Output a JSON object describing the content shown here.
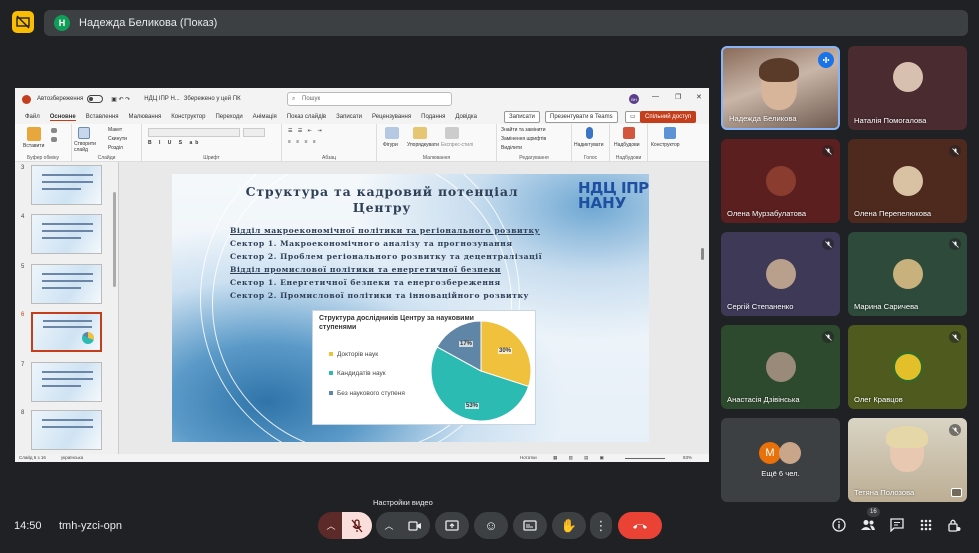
{
  "header": {
    "presenter_initial": "Н",
    "presenting_title": "Надежда Беликова (Показ)"
  },
  "ppt": {
    "autosave_label": "Автозбереження",
    "filename": "НДЦ ІПР Н...",
    "saved_status": "Збережено у цей ПК",
    "search_placeholder": "Пошук",
    "user_initials": "ВН",
    "menu": [
      "Файл",
      "Основне",
      "Вставлення",
      "Малювання",
      "Конструктор",
      "Переходи",
      "Анімація",
      "Показ слайдів",
      "Записати",
      "Рецензування",
      "Подання",
      "Довідка"
    ],
    "record_button": "Записати",
    "teams_button": "Презентувати в Teams",
    "share_button": "Спільний доступ",
    "ribbon": {
      "paste": "Вставити",
      "new_slide": "Створити слайд",
      "layout": "Макет",
      "reset": "Скинути",
      "section": "Розділ",
      "shapes": "Фігури",
      "arrange": "Упорядкувати",
      "quick_styles": "Експрес-стилі",
      "find_replace": "Знайти та замінити",
      "replace_fonts": "Замінення шрифтів",
      "select": "Виділити",
      "dictate": "Надиктувати",
      "addins": "Надбудови",
      "designer": "Конструктор",
      "groups": [
        "Буфер обміну",
        "Слайди",
        "Шрифт",
        "Абзац",
        "Малювання",
        "Редагування",
        "Голос",
        "Надбудови"
      ]
    },
    "thumb_numbers": [
      "3",
      "4",
      "5",
      "6",
      "7",
      "8"
    ],
    "status_slide": "Слайд 6 з 16",
    "status_lang": "українська",
    "status_notes": "Нотатки",
    "status_zoom": "83%"
  },
  "slide": {
    "title_line1": "Структура та кадровий потенціал",
    "title_line2": "Центру",
    "logo_line1": "НДЦ ІПР",
    "logo_line2": "НАНУ",
    "lines": [
      "Відділ макроекономічної політики та регіонального розвитку",
      "Сектор 1. Макроекономічного аналізу та прогнозування",
      "Сектор 2. Проблем регіонального розвитку та децентралізації",
      "Відділ промислової політики та енергетичної безпеки",
      "Сектор 1. Енергетичної безпеки та енергозбереження",
      "Сектор 2. Промислової політики та інноваційного розвитку"
    ]
  },
  "chart_data": {
    "type": "pie",
    "title": "Структура дослідників Центру за науковими ступенями",
    "categories": [
      "Докторів наук",
      "Кандидатів наук",
      "Без наукового ступеня"
    ],
    "values": [
      30,
      53,
      17
    ],
    "value_labels": [
      "30%",
      "53%",
      "17%"
    ],
    "colors": [
      "#f0c13c",
      "#2bbbb3",
      "#5f86a6"
    ],
    "legend": "left"
  },
  "participants": [
    {
      "name": "Надежда Беликова",
      "speaking": true
    },
    {
      "name": "Наталія Помогалова"
    },
    {
      "name": "Олена Мурзабулатова"
    },
    {
      "name": "Олена Перепелюкова"
    },
    {
      "name": "Сергій Степаненко"
    },
    {
      "name": "Марина Саричева"
    },
    {
      "name": "Анастасія Дзівінська"
    },
    {
      "name": "Олег Кравцов"
    },
    {
      "name": "Ещё 6 чел.",
      "initial": "М"
    },
    {
      "name": "Тетяна Полозова"
    }
  ],
  "bottom": {
    "time": "14:50",
    "meeting_code": "tmh-yzci-opn",
    "tooltip": "Настройки видео",
    "participant_count": "16"
  },
  "colors": {
    "end_call": "#ea4335",
    "mic_muted": "#f9dedc",
    "accent_blue": "#1a73e8"
  }
}
